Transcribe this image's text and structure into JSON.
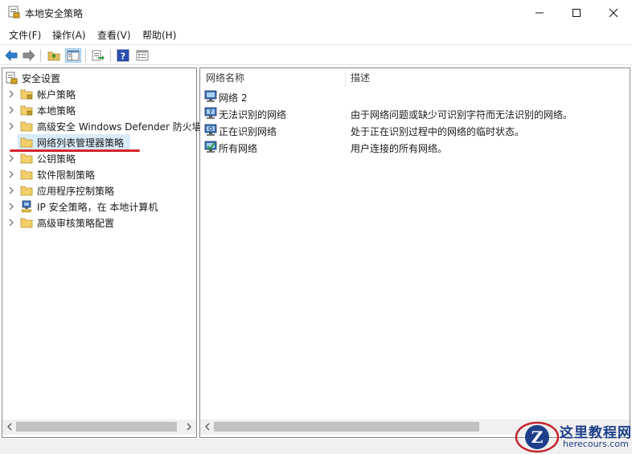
{
  "window": {
    "title": "本地安全策略",
    "controls": [
      "minimize",
      "maximize",
      "close"
    ]
  },
  "menubar": {
    "items": [
      "文件(F)",
      "操作(A)",
      "查看(V)",
      "帮助(H)"
    ]
  },
  "toolbar": {
    "buttons": [
      "back-arrow-icon",
      "forward-arrow-icon",
      "up-folder-icon",
      "show-hide-tree-icon",
      "export-list-icon",
      "help-icon",
      "properties-icon"
    ]
  },
  "tree": {
    "root": "安全设置",
    "items": [
      {
        "label": "帐户策略",
        "expandable": true
      },
      {
        "label": "本地策略",
        "expandable": true
      },
      {
        "label": "高级安全 Windows Defender 防火墙",
        "expandable": true
      },
      {
        "label": "网络列表管理器策略",
        "expandable": false,
        "selected": true
      },
      {
        "label": "公钥策略",
        "expandable": true
      },
      {
        "label": "软件限制策略",
        "expandable": true
      },
      {
        "label": "应用程序控制策略",
        "expandable": true
      },
      {
        "label": "IP 安全策略，在 本地计算机",
        "expandable": true
      },
      {
        "label": "高级审核策略配置",
        "expandable": true
      }
    ]
  },
  "list": {
    "columns": [
      "网络名称",
      "描述"
    ],
    "rows": [
      {
        "name": "网络 2",
        "desc": ""
      },
      {
        "name": "无法识别的网络",
        "desc": "由于网络问题或缺少可识别字符而无法识别的网络。"
      },
      {
        "name": "正在识别网络",
        "desc": "处于正在识别过程中的网络的临时状态。"
      },
      {
        "name": "所有网络",
        "desc": "用户连接的所有网络。"
      }
    ]
  },
  "watermark": {
    "title": "这里教程网",
    "site": "herecours.com"
  },
  "colors": {
    "selection": "#d9ebf9",
    "annotation_red": "#d6242c",
    "watermark_blue": "#1d3f8a"
  }
}
